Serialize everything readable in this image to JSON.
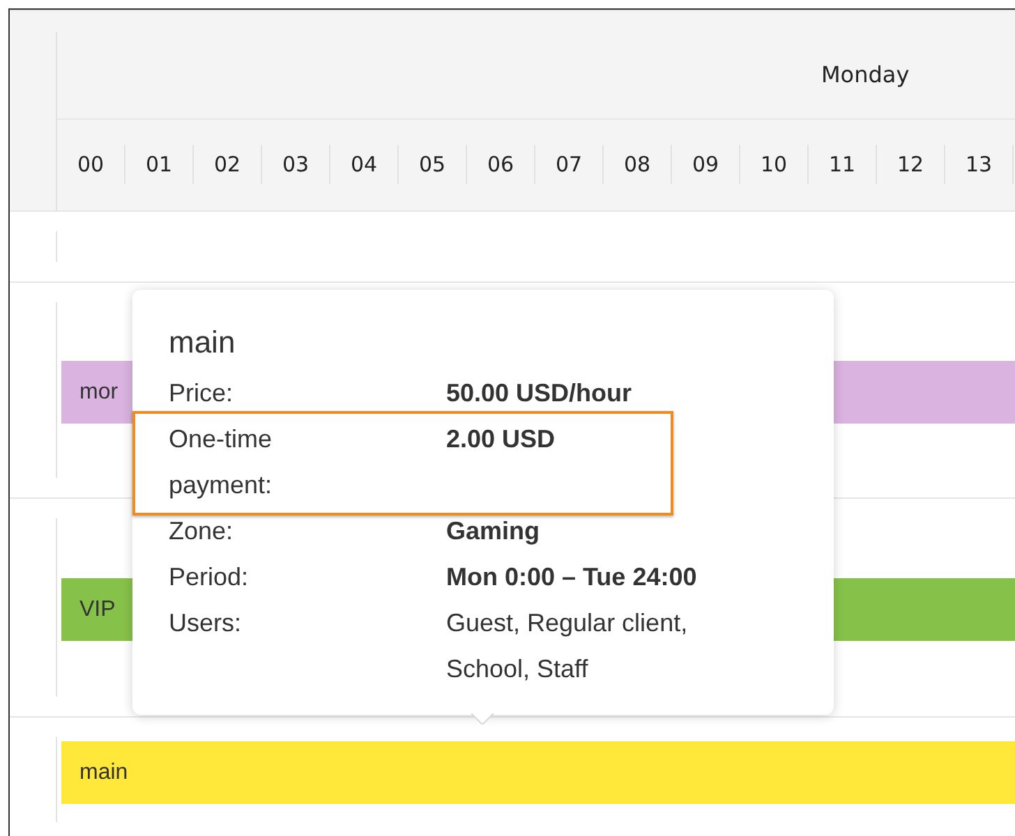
{
  "schedule": {
    "day": "Monday",
    "hours": [
      "00",
      "01",
      "02",
      "03",
      "04",
      "05",
      "06",
      "07",
      "08",
      "09",
      "10",
      "11",
      "12",
      "13"
    ],
    "rows": [
      {
        "bar": null
      },
      {
        "bar": {
          "label": "mor",
          "color": "#dab3e0"
        }
      },
      {
        "bar": {
          "label": "VIP",
          "color": "#86c24a"
        }
      },
      {
        "bar": {
          "label": "main",
          "color": "#ffe83a"
        }
      }
    ]
  },
  "tooltip": {
    "title": "main",
    "fields": [
      {
        "label": "Price:",
        "value": "50.00 USD/hour",
        "bold": true,
        "highlighted": false
      },
      {
        "label": "One-time payment:",
        "value": "2.00 USD",
        "bold": true,
        "highlighted": true
      },
      {
        "label": "Zone:",
        "value": "Gaming",
        "bold": true,
        "highlighted": false
      },
      {
        "label": "Period:",
        "value": "Mon 0:00 – Tue 24:00",
        "bold": true,
        "highlighted": false
      },
      {
        "label": "Users:",
        "value": "Guest, Regular client, School, Staff",
        "bold": false,
        "highlighted": false
      }
    ]
  }
}
